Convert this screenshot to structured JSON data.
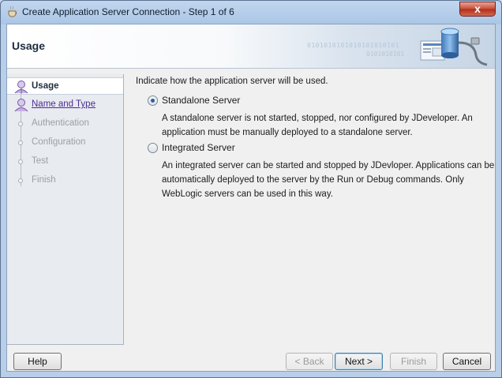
{
  "window": {
    "title": "Create Application Server Connection - Step 1 of 6",
    "close_glyph": "x"
  },
  "header": {
    "title": "Usage",
    "graphic_icon": "server-connection-icon",
    "binary_line1": "0101010101010101010101",
    "binary_line2": "0101010101"
  },
  "nav": {
    "items": [
      {
        "label": "Usage",
        "state": "active"
      },
      {
        "label": "Name and Type",
        "state": "link"
      },
      {
        "label": "Authentication",
        "state": "disabled"
      },
      {
        "label": "Configuration",
        "state": "disabled"
      },
      {
        "label": "Test",
        "state": "disabled"
      },
      {
        "label": "Finish",
        "state": "disabled"
      }
    ]
  },
  "content": {
    "intro": "Indicate how the application server will be used.",
    "options": [
      {
        "label": "Standalone Server",
        "checked": true,
        "description": [
          "A standalone server is not started, stopped, nor configured by JDeveloper. An",
          "application must be manually deployed to a standalone server."
        ]
      },
      {
        "label": "Integrated Server",
        "checked": false,
        "description": [
          "An integrated server can be started and stopped by JDevloper. Applications can be",
          "automatically deployed to the server by the Run or Debug commands. Only",
          "WebLogic servers can be used in this way."
        ]
      }
    ]
  },
  "buttons": {
    "help": "Help",
    "back": "< Back",
    "next": "Next >",
    "finish": "Finish",
    "cancel": "Cancel"
  }
}
